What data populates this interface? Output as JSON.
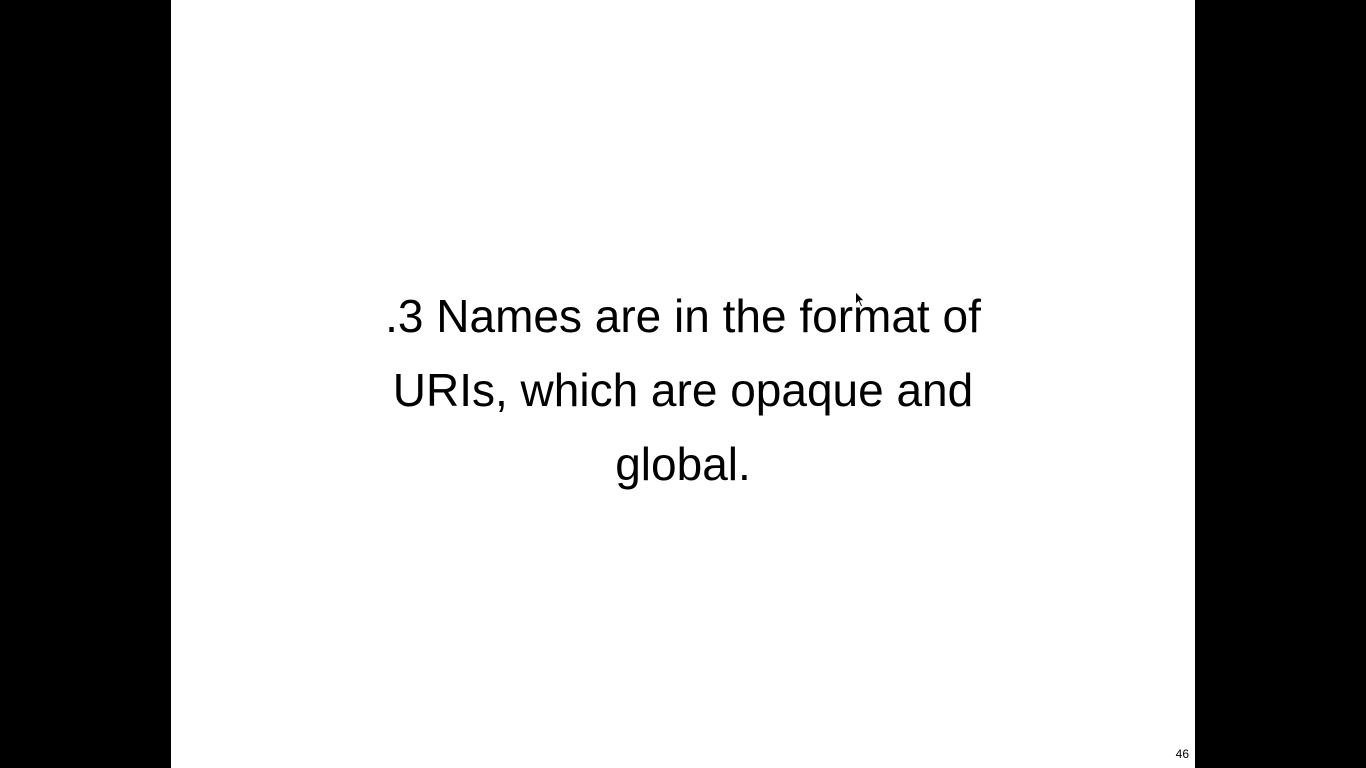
{
  "slide": {
    "text_lines": [
      ".3 Names are in the format of",
      "URIs, which are opaque and",
      "global."
    ],
    "page_number": "46"
  },
  "colors": {
    "letterbox": "#000000",
    "slide_background": "#ffffff",
    "text": "#000000"
  },
  "icons": {
    "cursor": "mouse-pointer-icon"
  }
}
